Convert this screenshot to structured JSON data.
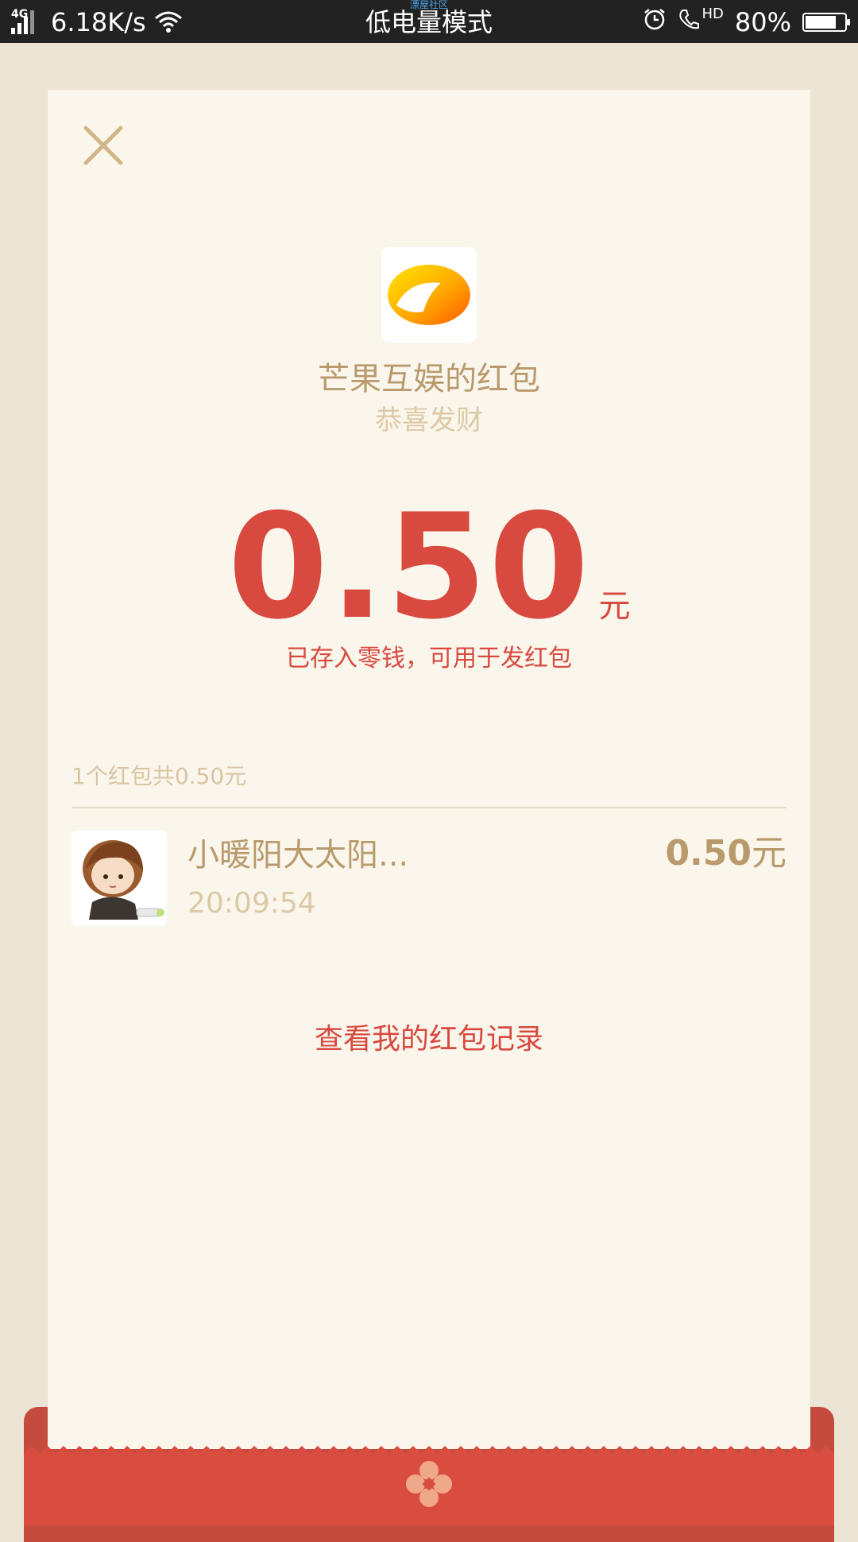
{
  "status_bar": {
    "network_type": "4G",
    "speed": "6.18K/s",
    "mode": "低电量模式",
    "watermark": "漂屋社区",
    "call_hd": "HD",
    "battery": "80%",
    "battery_level": 0.8
  },
  "card": {
    "sender_title": "芒果互娱的红包",
    "wish": "恭喜发财",
    "amount": "0.50",
    "amount_unit": "元",
    "amount_note": "已存入零钱，可用于发红包",
    "summary": "1个红包共0.50元",
    "record": {
      "name": "小暖阳大太阳...",
      "time": "20:09:54",
      "amount": "0.50",
      "amount_unit": "元"
    },
    "history_link": "查看我的红包记录"
  },
  "colors": {
    "accent_red": "#d8493f",
    "gold": "#b89a6c",
    "light_gold": "#dcc9a6",
    "card_bg": "#faf6ec",
    "page_bg": "#ece4d4"
  },
  "icons": {
    "close": "close-icon",
    "logo": "mango-tv-logo-icon",
    "flower": "flower-icon"
  }
}
